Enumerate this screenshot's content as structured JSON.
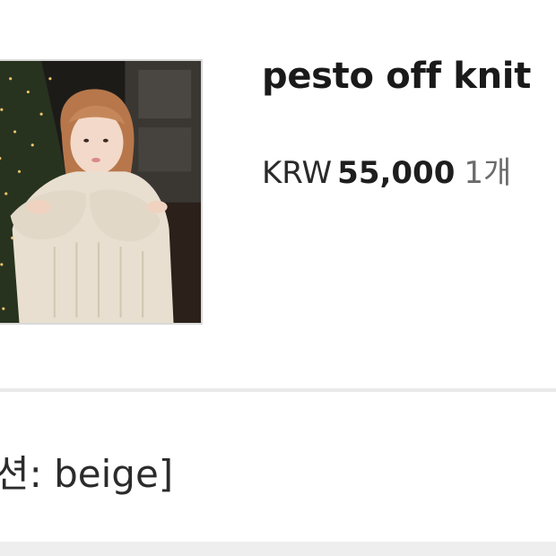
{
  "product": {
    "name": "pesto off knit",
    "currency": "KRW",
    "price": "55,000",
    "quantity": "1개",
    "option_text": "션: beige]"
  },
  "colors": {
    "divider": "#e9e9e9",
    "sweater": "#e8dfd0",
    "background": "#1c1a17"
  }
}
